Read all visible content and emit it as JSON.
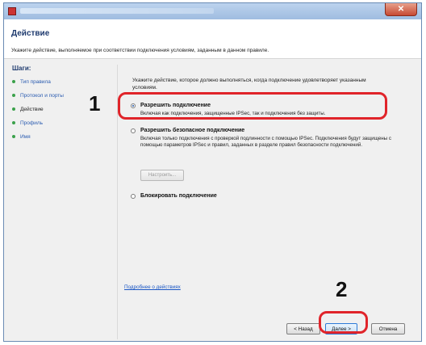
{
  "dialog": {
    "close_glyph": "✕",
    "title": "Действие",
    "description": "Укажите действие, выполняемое при соответствии подключения условиям, заданным в данном правиле."
  },
  "steps": {
    "title": "Шаги:",
    "items": [
      {
        "label": "Тип правила"
      },
      {
        "label": "Протокол и порты"
      },
      {
        "label": "Действие"
      },
      {
        "label": "Профиль"
      },
      {
        "label": "Имя"
      }
    ]
  },
  "main": {
    "intro": "Укажите действие, которое должно выполняться, когда подключение удовлетворяет указанным условиям.",
    "options": [
      {
        "label": "Разрешить подключение",
        "desc": "Включая как подключения, защищенные IPSec, так и подключения без защиты.",
        "checked": true
      },
      {
        "label": "Разрешить безопасное подключение",
        "desc": "Включая только подключения с проверкой подлинности с помощью IPSec. Подключения будут защищены с помощью параметров IPSec и правил, заданных в разделе правил безопасности подключений.",
        "checked": false
      },
      {
        "label": "Блокировать подключение",
        "desc": "",
        "checked": false
      }
    ],
    "customize_label": "Настроить...",
    "help_link": "Подробнее о действиях"
  },
  "footer": {
    "back_label": "< Назад",
    "next_label": "Далее >",
    "cancel_label": "Отмена"
  },
  "callouts": {
    "step1": "1",
    "step2": "2",
    "ring_color": "#e0242a"
  }
}
